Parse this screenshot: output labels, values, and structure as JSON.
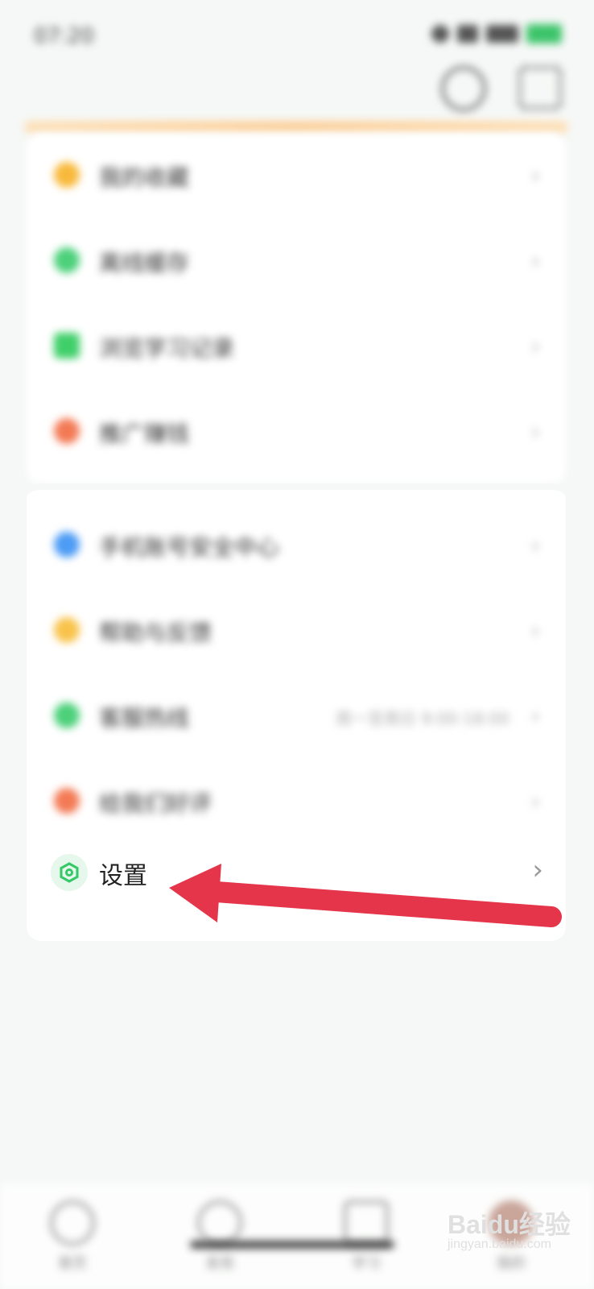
{
  "status_bar": {
    "time": "07:20"
  },
  "menu_group_1": [
    {
      "label": "我的收藏",
      "icon": "star-icon",
      "color": "#f8b93b"
    },
    {
      "label": "离线缓存",
      "icon": "download-icon",
      "color": "#4cd07a"
    },
    {
      "label": "浏览学习记录",
      "icon": "history-icon",
      "color": "#3fcf69"
    },
    {
      "label": "推广赚钱",
      "icon": "coin-icon",
      "color": "#f37a55"
    }
  ],
  "menu_group_2": [
    {
      "label": "手机账号安全中心",
      "icon": "shield-icon",
      "color": "#4c9bf5",
      "extra": ""
    },
    {
      "label": "帮助与反馈",
      "icon": "help-icon",
      "color": "#f8c34b",
      "extra": ""
    },
    {
      "label": "客服热线",
      "icon": "phone-icon",
      "color": "#4cd07a",
      "extra": "周一至周日 9:00-18:00"
    },
    {
      "label": "给我们好评",
      "icon": "heart-icon",
      "color": "#f37a55",
      "extra": ""
    }
  ],
  "settings": {
    "label": "设置",
    "color": "#35c866"
  },
  "annotation": {
    "arrow_color": "#e5354a"
  },
  "bottom_nav": [
    {
      "label": "首页",
      "icon": "home-icon"
    },
    {
      "label": "发现",
      "icon": "discover-icon"
    },
    {
      "label": "学习",
      "icon": "book-icon"
    },
    {
      "label": "我的",
      "icon": "avatar-icon"
    }
  ],
  "watermark": {
    "brand": "Baidu经验",
    "url": "jingyan.baidu.com"
  }
}
